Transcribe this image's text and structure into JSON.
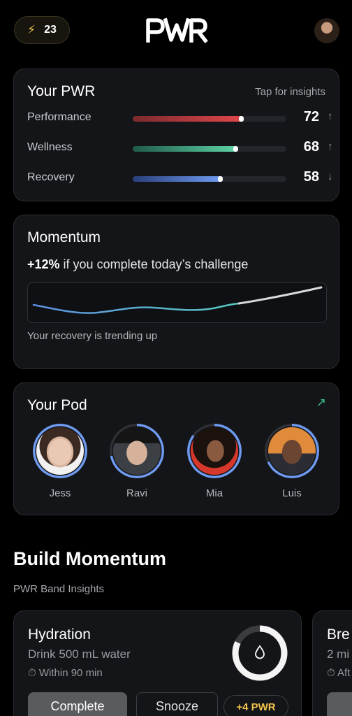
{
  "header": {
    "streak_icon": "lightning-bolt-icon",
    "streak_count": "23",
    "logo_text": "PWR",
    "avatar": "profile-avatar"
  },
  "pwr_card": {
    "title": "Your PWR",
    "action": "Tap for insights",
    "metrics": [
      {
        "label": "Performance",
        "value": "72",
        "trend": "↑",
        "level": 0.72,
        "color_from": "#7a2a2e",
        "color_to": "#e0474c"
      },
      {
        "label": "Wellness",
        "value": "68",
        "trend": "↑",
        "level": 0.68,
        "color_from": "#1e5a4a",
        "color_to": "#5fd3a6"
      },
      {
        "label": "Recovery",
        "value": "58",
        "trend": "↓",
        "level": 0.58,
        "color_from": "#2a3f7a",
        "color_to": "#6f9cf2"
      }
    ]
  },
  "momentum": {
    "title": "Momentum",
    "highlight": "+12%",
    "headline_rest": " if you complete today’s challenge",
    "subtitle": "Your recovery is trending up"
  },
  "pod": {
    "title": "Your Pod",
    "expand_icon": "expand-arrow-icon",
    "members": [
      {
        "name": "Jess",
        "progress": 1.0
      },
      {
        "name": "Ravi",
        "progress": 0.72
      },
      {
        "name": "Mia",
        "progress": 0.85
      },
      {
        "name": "Luis",
        "progress": 0.68
      }
    ]
  },
  "build": {
    "title": "Build Momentum",
    "subtitle": "PWR Band Insights",
    "hydration": {
      "title": "Hydration",
      "description": "Drink 500 mL water",
      "time_icon": "timer-icon",
      "time": "Within 90 min",
      "progress_icon": "water-drop-icon",
      "progress": 0.82,
      "complete_label": "Complete",
      "snooze_label": "Snooze",
      "reward": "+4 PWR"
    },
    "next_card": {
      "title": "Bre",
      "description": "2 mi",
      "time": "Aft"
    }
  }
}
